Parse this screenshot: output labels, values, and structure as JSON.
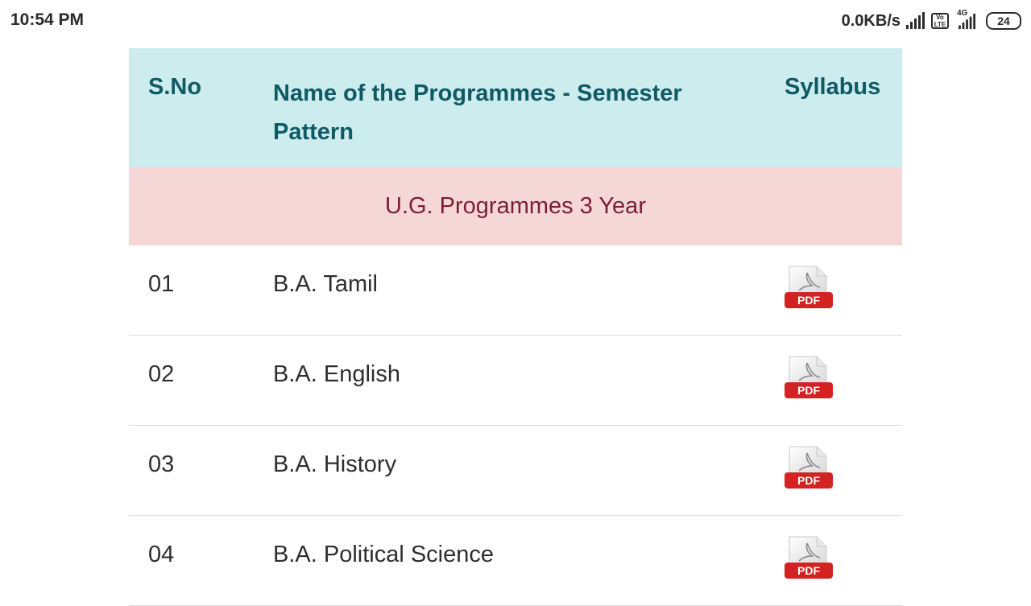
{
  "status_bar": {
    "time": "10:54 PM",
    "net_speed": "0.0KB/s",
    "volte_top": "Vo",
    "volte_bottom": "LTE",
    "network_type": "4G",
    "battery": "24",
    "icons": [
      "signal-icon",
      "volte-icon",
      "signal-4g-icon",
      "battery-icon"
    ]
  },
  "table": {
    "headers": {
      "sno": "S.No",
      "name": "Name of the Programmes - Semester Pattern",
      "syllabus": "Syllabus"
    },
    "section_title": "U.G. Programmes 3 Year",
    "pdf_icon_label": "PDF",
    "rows": [
      {
        "sno": "01",
        "name": "B.A. Tamil"
      },
      {
        "sno": "02",
        "name": "B.A. English"
      },
      {
        "sno": "03",
        "name": "B.A. History"
      },
      {
        "sno": "04",
        "name": "B.A. Political Science"
      }
    ]
  },
  "colors": {
    "header_bg": "#cdecee",
    "header_text": "#0f5a63",
    "section_bg": "#f6d7d7",
    "section_text": "#7b1e2e",
    "pdf_red": "#d22222"
  }
}
